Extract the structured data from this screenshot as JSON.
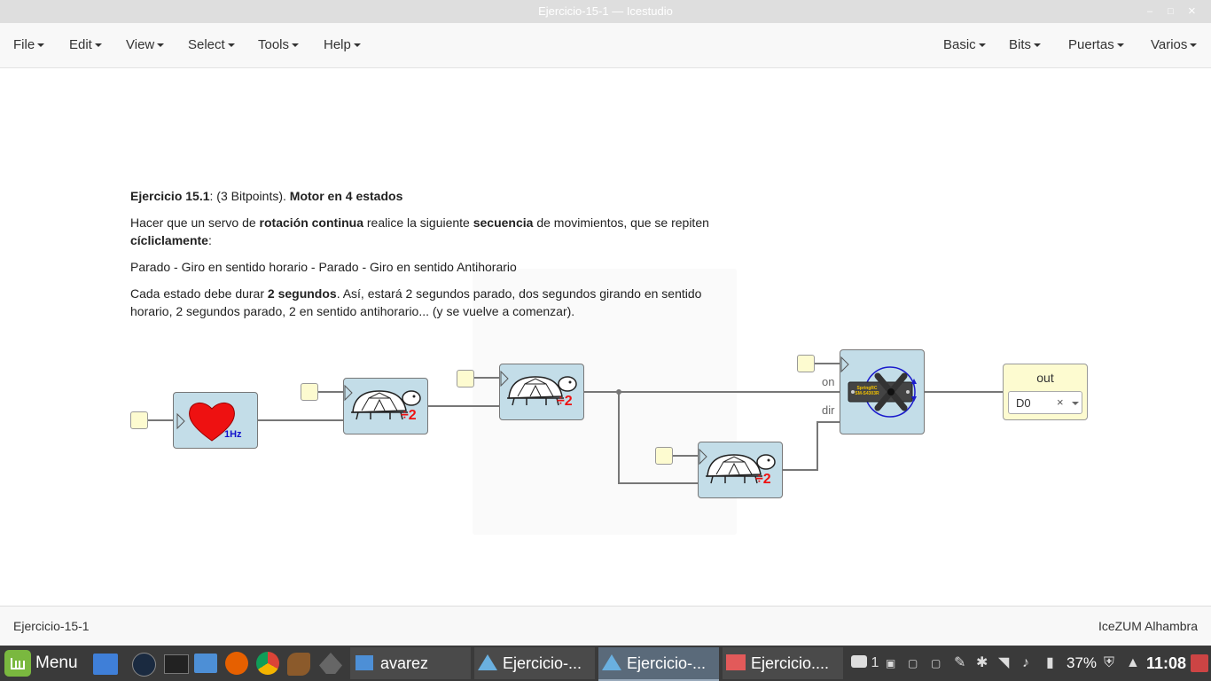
{
  "window": {
    "title": "Ejercicio-15-1 — Icestudio",
    "minimize": "–",
    "maximize": "□",
    "close": "×"
  },
  "menubar": {
    "left": [
      "File",
      "Edit",
      "View",
      "Select",
      "Tools",
      "Help"
    ],
    "right": [
      "Basic",
      "Bits",
      "Puertas",
      "Varios"
    ]
  },
  "description": {
    "line1": {
      "b1": "Ejercicio 15.1",
      "t1": ": (3 Bitpoints). ",
      "b2": "Motor en 4 estados"
    },
    "line2": {
      "t1": "Hacer que un servo de ",
      "b1": "rotación continua",
      "t2": " realice la siguiente ",
      "b2": "secuencia",
      "t3": " de movimientos, que se repiten ",
      "b3": "cícliclamente",
      "t4": ":"
    },
    "line3": "Parado - Giro en sentido horario - Parado - Giro en sentido Antihorario",
    "line4": {
      "t1": "Cada estado debe durar ",
      "b1": "2 segundos",
      "t2": ". Así, estará 2 segundos parado, dos segundos girando en sentido horario, 2 segundos parado, 2 en sentido antihorario... (y se vuelve a comenzar)."
    }
  },
  "circuit": {
    "heart_label": "1Hz",
    "divider_label": "÷2",
    "servo_label": "SpringRC SM-S4303R",
    "servo_ports": {
      "on": "on",
      "dir": "dir"
    },
    "output": {
      "name": "out",
      "pin": "D0",
      "clear": "×"
    }
  },
  "statusbar": {
    "left": "Ejercicio-15-1",
    "right": "IceZUM Alhambra"
  },
  "taskbar": {
    "menu": "Menu",
    "tasks": [
      "avarez",
      "Ejercicio-...",
      "Ejercicio-...",
      "Ejercicio...."
    ],
    "notifications": "1",
    "battery": "37%",
    "clock": "11:08"
  }
}
